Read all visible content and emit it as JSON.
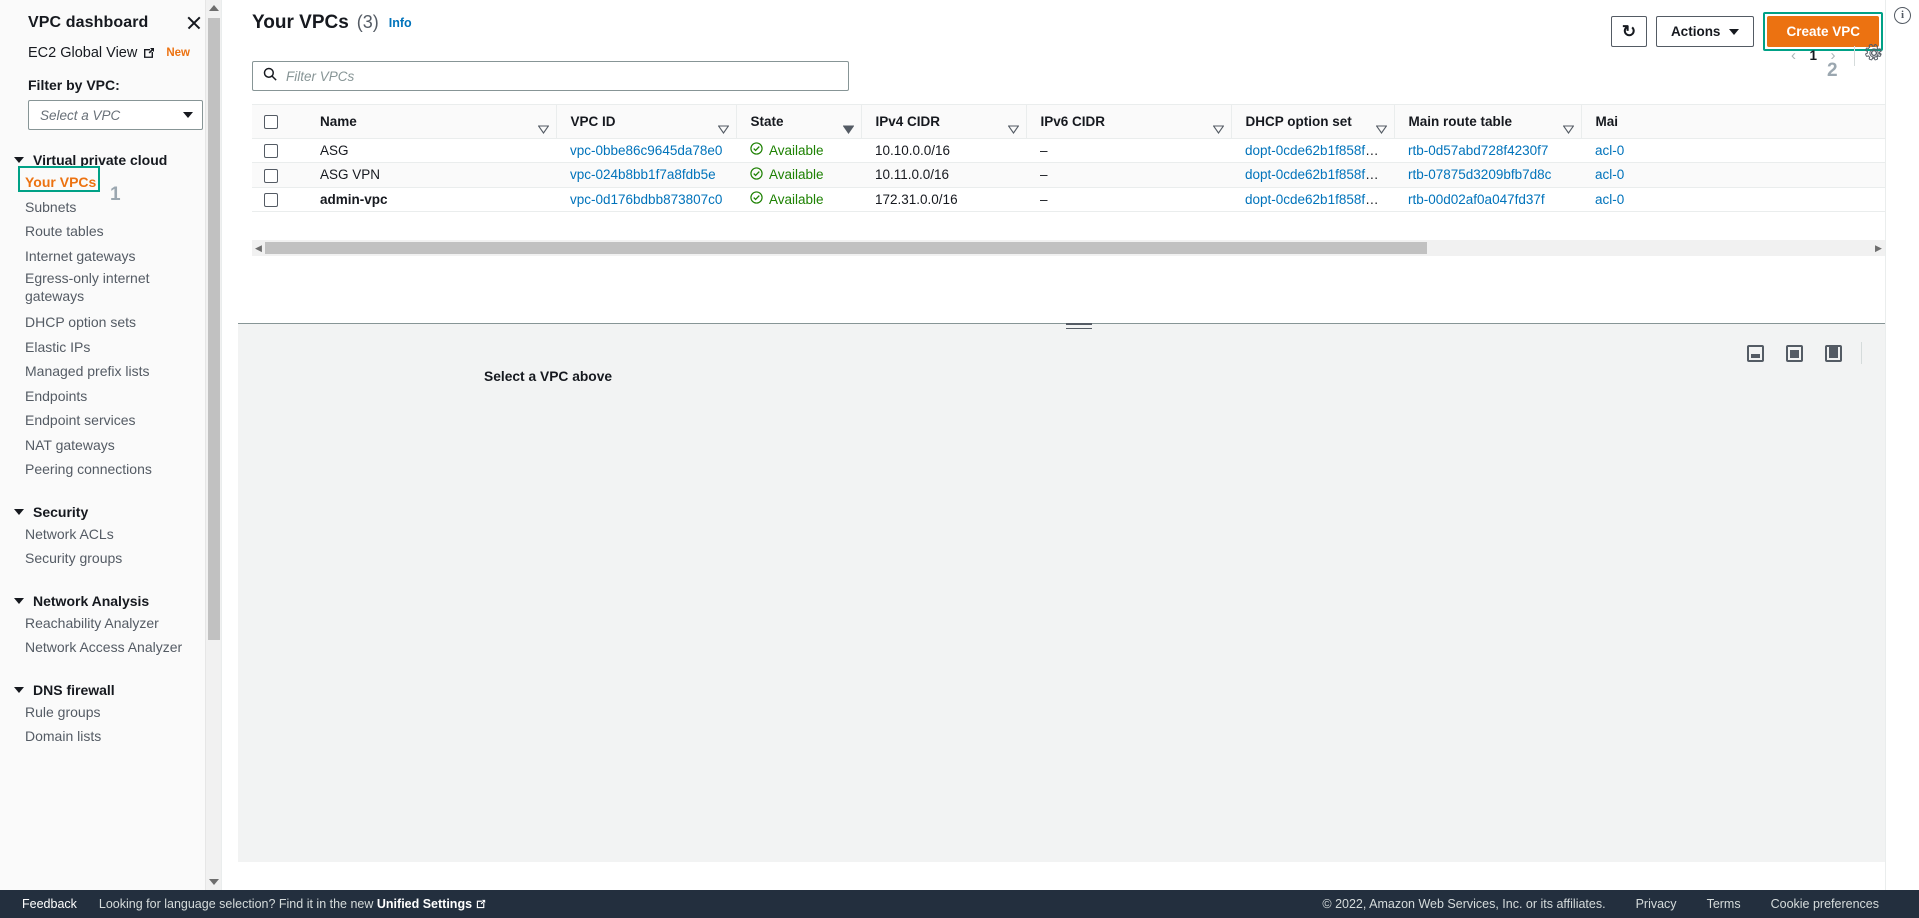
{
  "sidebar": {
    "title": "VPC dashboard",
    "close_icon": "close-icon",
    "global_view": {
      "label": "EC2 Global View",
      "external_icon": "external-link-icon",
      "badge": "New"
    },
    "filter_label": "Filter by VPC:",
    "filter_select_placeholder": "Select a VPC",
    "sections": [
      {
        "label": "Virtual private cloud",
        "items": [
          {
            "label": "Your VPCs",
            "active": true
          },
          {
            "label": "Subnets",
            "active": false
          },
          {
            "label": "Route tables",
            "active": false
          },
          {
            "label": "Internet gateways",
            "active": false
          },
          {
            "label": "Egress-only internet gateways",
            "active": false
          },
          {
            "label": "DHCP option sets",
            "active": false
          },
          {
            "label": "Elastic IPs",
            "active": false
          },
          {
            "label": "Managed prefix lists",
            "active": false
          },
          {
            "label": "Endpoints",
            "active": false
          },
          {
            "label": "Endpoint services",
            "active": false
          },
          {
            "label": "NAT gateways",
            "active": false
          },
          {
            "label": "Peering connections",
            "active": false
          }
        ]
      },
      {
        "label": "Security",
        "items": [
          {
            "label": "Network ACLs",
            "active": false
          },
          {
            "label": "Security groups",
            "active": false
          }
        ]
      },
      {
        "label": "Network Analysis",
        "items": [
          {
            "label": "Reachability Analyzer",
            "active": false
          },
          {
            "label": "Network Access Analyzer",
            "active": false
          }
        ]
      },
      {
        "label": "DNS firewall",
        "items": [
          {
            "label": "Rule groups",
            "active": false
          },
          {
            "label": "Domain lists",
            "active": false
          }
        ]
      }
    ]
  },
  "annotations": {
    "step1": "1",
    "step2": "2"
  },
  "header": {
    "title": "Your VPCs",
    "count": "(3)",
    "info_label": "Info",
    "refresh_icon": "refresh-icon",
    "actions_label": "Actions",
    "create_label": "Create VPC",
    "accent_orange": "#ec7211",
    "highlight_teal": "#00a186"
  },
  "search": {
    "placeholder": "Filter VPCs",
    "value": "",
    "icon": "search-icon"
  },
  "pagination": {
    "prev_icon": "chevron-left-icon",
    "page": "1",
    "next_icon": "chevron-right-icon",
    "settings_icon": "gear-icon"
  },
  "table": {
    "columns": [
      {
        "label": "Name",
        "sortable": true
      },
      {
        "label": "VPC ID",
        "sortable": true
      },
      {
        "label": "State",
        "sortable": true
      },
      {
        "label": "IPv4 CIDR",
        "sortable": true
      },
      {
        "label": "IPv6 CIDR",
        "sortable": true
      },
      {
        "label": "DHCP option set",
        "sortable": true
      },
      {
        "label": "Main route table",
        "sortable": true
      },
      {
        "label": "Mai",
        "sortable": false
      }
    ],
    "rows": [
      {
        "name": "ASG",
        "name_bold": false,
        "vpc_id": "vpc-0bbe86c9645da78e0",
        "state": "Available",
        "ipv4": "10.10.0.0/16",
        "ipv6": "–",
        "dhcp": "dopt-0cde62b1f858fc...",
        "route_table": "rtb-0d57abd728f4230f7",
        "acl": "acl-0"
      },
      {
        "name": "ASG VPN",
        "name_bold": false,
        "vpc_id": "vpc-024b8bb1f7a8fdb5e",
        "state": "Available",
        "ipv4": "10.11.0.0/16",
        "ipv6": "–",
        "dhcp": "dopt-0cde62b1f858fc...",
        "route_table": "rtb-07875d3209bfb7d8c",
        "acl": "acl-0"
      },
      {
        "name": "admin-vpc",
        "name_bold": true,
        "vpc_id": "vpc-0d176bdbb873807c0",
        "state": "Available",
        "ipv4": "172.31.0.0/16",
        "ipv6": "–",
        "dhcp": "dopt-0cde62b1f858fc...",
        "route_table": "rtb-00d02af0a047fd37f",
        "acl": "acl-0"
      }
    ],
    "state_color": "#1d8102",
    "link_color": "#0073bb"
  },
  "split_panel": {
    "title": "Select a VPC above",
    "resize_handle": "split-panel-resize-handle",
    "size_icons": [
      "panel-small-icon",
      "panel-medium-icon",
      "panel-large-icon"
    ]
  },
  "info_rail": {
    "icon": "info-circle-icon"
  },
  "footer": {
    "feedback": "Feedback",
    "language_note": "Looking for language selection? Find it in the new",
    "unified_settings": "Unified Settings",
    "external_icon": "external-link-icon",
    "copyright": "© 2022, Amazon Web Services, Inc. or its affiliates.",
    "links": [
      "Privacy",
      "Terms",
      "Cookie preferences"
    ]
  }
}
